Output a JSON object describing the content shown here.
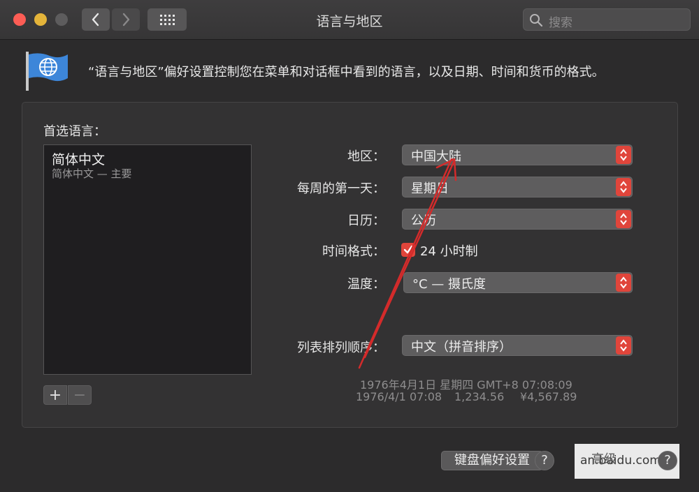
{
  "window": {
    "title": "语言与地区"
  },
  "search": {
    "placeholder": "搜索"
  },
  "description": "“语言与地区”偏好设置控制您在菜单和对话框中看到的语言，以及日期、时间和货币的格式。",
  "preferred_languages": {
    "label": "首选语言：",
    "items": [
      {
        "name": "简体中文",
        "sub": "简体中文 — 主要"
      }
    ],
    "add_label": "+",
    "remove_label": "−"
  },
  "settings": {
    "region": {
      "label": "地区：",
      "value": "中国大陆"
    },
    "first_day": {
      "label": "每周的第一天：",
      "value": "星期日"
    },
    "calendar": {
      "label": "日历：",
      "value": "公历"
    },
    "time_format": {
      "label": "时间格式：",
      "checkbox_label": "24 小时制",
      "checked": true
    },
    "temperature": {
      "label": "温度：",
      "value": "°C — 摄氏度"
    },
    "sort_order": {
      "label": "列表排列顺序：",
      "value": "中文（拼音排序）"
    }
  },
  "sample": {
    "line1": "1976年4月1日 星期四 GMT+8 07:08:09",
    "line2_date": "1976/4/1 07:08",
    "line2_number": "1,234.56",
    "line2_currency": "¥4,567.89"
  },
  "buttons": {
    "keyboard_prefs": "键盘偏好设置",
    "advanced": "高级",
    "help": "?"
  },
  "watermark": {
    "text": "an.baidu.com"
  },
  "colors": {
    "accent": "#e0453b",
    "annotation": "#d42b2b"
  }
}
